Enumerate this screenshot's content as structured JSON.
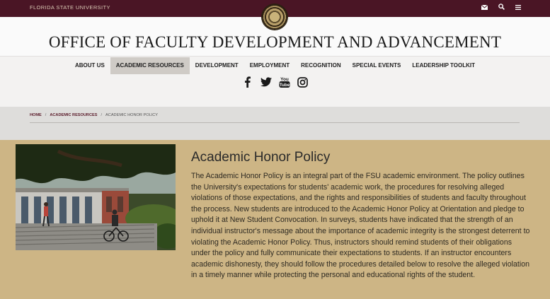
{
  "topbar": {
    "university": "FLORIDA STATE UNIVERSITY",
    "icons": [
      "envelope-icon",
      "search-icon",
      "menu-icon"
    ]
  },
  "header": {
    "title": "OFFICE OF FACULTY DEVELOPMENT AND ADVANCEMENT"
  },
  "nav": {
    "items": [
      {
        "label": "ABOUT US"
      },
      {
        "label": "ACADEMIC RESOURCES"
      },
      {
        "label": "DEVELOPMENT"
      },
      {
        "label": "EMPLOYMENT"
      },
      {
        "label": "RECOGNITION"
      },
      {
        "label": "SPECIAL EVENTS"
      },
      {
        "label": "LEADERSHIP TOOLKIT"
      }
    ],
    "active": "ACADEMIC RESOURCES"
  },
  "social": [
    "facebook-icon",
    "twitter-icon",
    "youtube-icon",
    "instagram-icon"
  ],
  "breadcrumb": {
    "home": "HOME",
    "section": "ACADEMIC RESOURCES",
    "current": "ACADEMIC HONOR POLICY"
  },
  "main": {
    "title": "Academic Honor Policy",
    "body": "The Academic Honor Policy is an integral part of the FSU academic environment. The policy outlines the University's expectations for students' academic work, the procedures for resolving alleged violations of those expectations, and the rights and responsibilities of students and faculty throughout the process. New students are introduced to the Academic Honor Policy at Orientation and pledge to uphold it at New Student Convocation. In surveys, students have indicated that the strength of an individual instructor's message about the importance of academic integrity is the strongest deterrent to violating the Academic Honor Policy. Thus, instructors should remind students of their obligations under the policy and fully communicate their expectations to students. If an instructor encounters academic dishonesty, they should follow the procedures detailed below to resolve the alleged violation in a timely manner while protecting the personal and educational rights of the student."
  },
  "colors": {
    "garnet": "#4a1525",
    "gold_background": "#cdb585",
    "active_nav": "#cfcbc6"
  }
}
